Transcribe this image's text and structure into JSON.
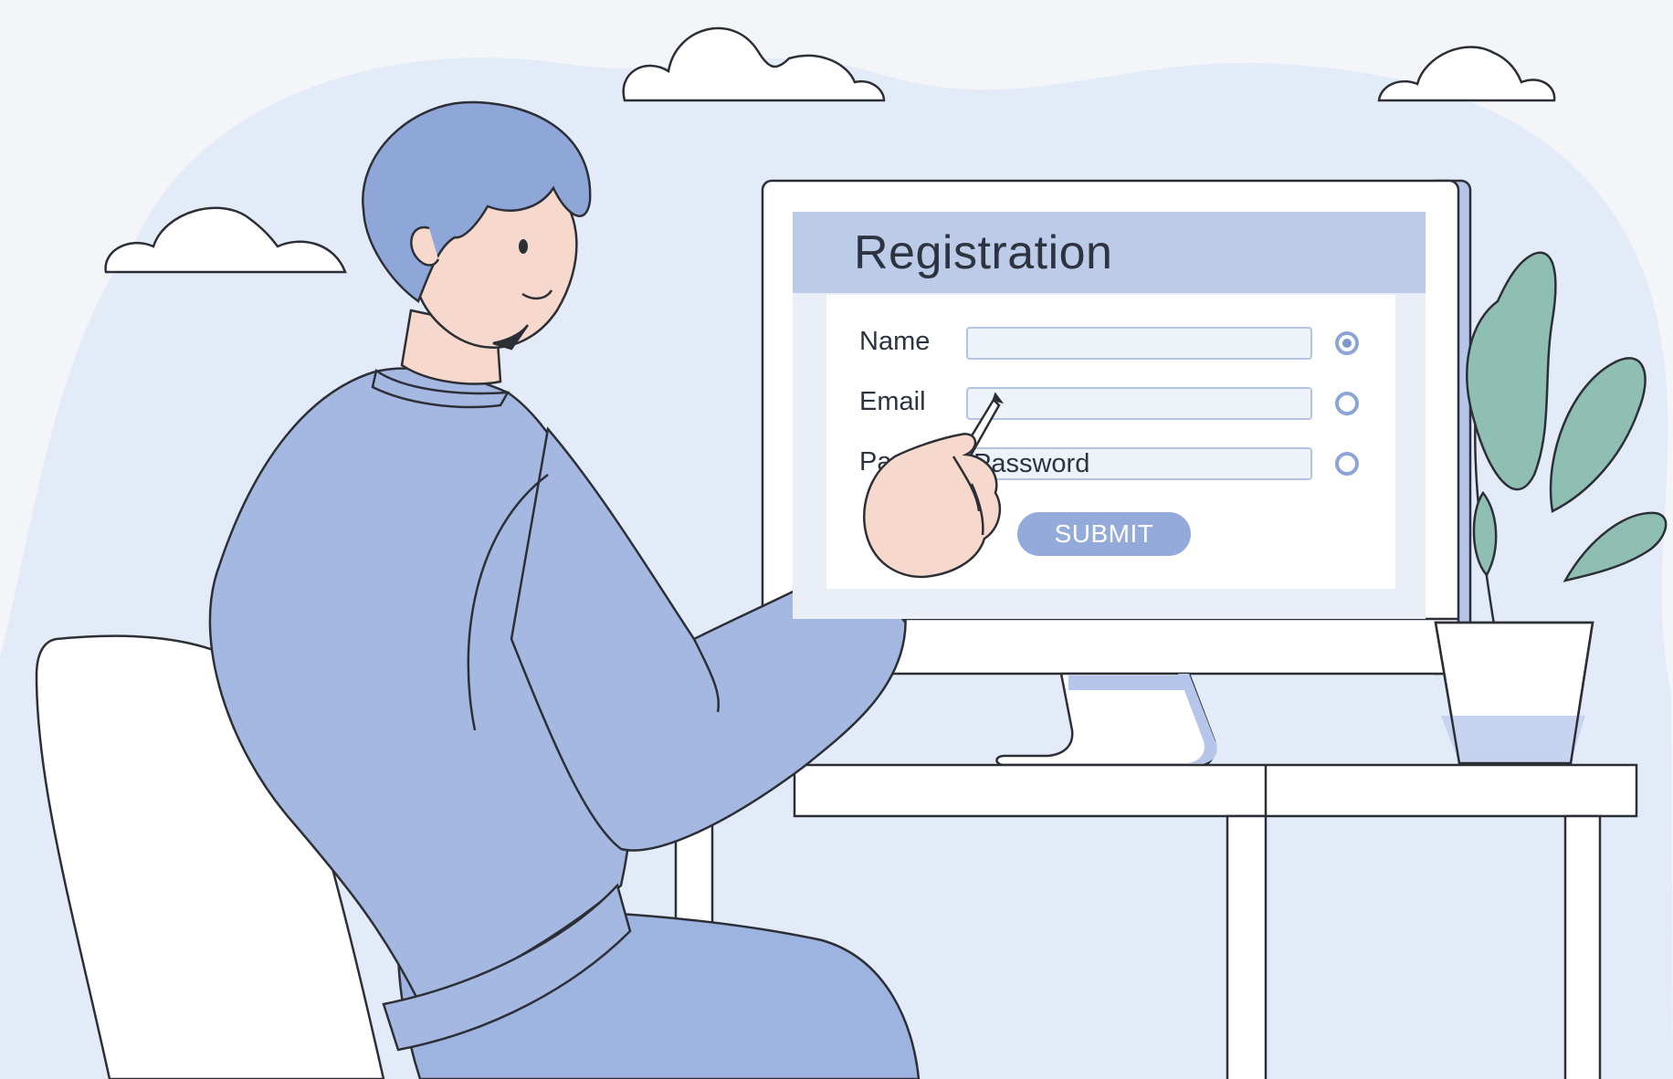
{
  "form": {
    "title": "Registration",
    "fields": [
      {
        "label": "Name",
        "value": "",
        "status_icon": "radio-checked"
      },
      {
        "label": "Email",
        "value": "",
        "status_icon": "radio-empty"
      },
      {
        "label": "Password",
        "value": "Password",
        "status_icon": "radio-empty"
      }
    ],
    "submit_label": "SUBMIT"
  },
  "colors": {
    "background": "#f3f5f8",
    "blob": "#e4ebf8",
    "sweater": "#a4b8e2",
    "hair": "#8ea6d8",
    "skin": "#f6d8cc",
    "plant": "#8fbfb3",
    "form_header": "#bccbe8",
    "button": "#93aada",
    "outline": "#2d2f36"
  },
  "icons": [
    "cloud-icon",
    "plant-icon",
    "stylus-icon",
    "radio-icon"
  ]
}
